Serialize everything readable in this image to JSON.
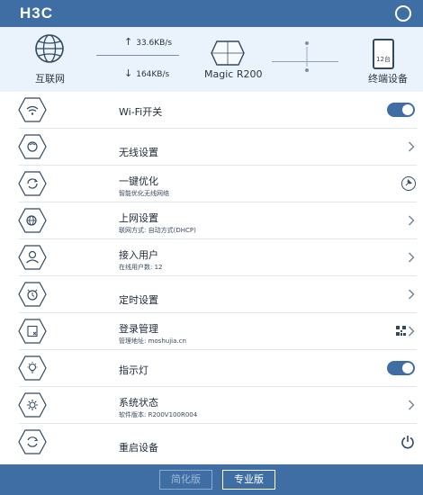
{
  "header": {
    "logo": "H3C",
    "icons": [
      "power-icon"
    ]
  },
  "status": {
    "internet_label": "互联网",
    "upload_rate": "33.6KB/s",
    "download_rate": "164KB/s",
    "router_label": "Magic R200",
    "devices_count": "12台",
    "devices_label": "终端设备"
  },
  "menu": [
    {
      "title": "Wi-Fi开关",
      "control": "toggle",
      "state": "on",
      "icon": "wifi-icon"
    },
    {
      "title": "无线设置",
      "control": "chevron",
      "icon": "wireless-settings-icon"
    },
    {
      "title": "一键优化",
      "subtitle": "智能优化无线网络",
      "control": "pin",
      "icon": "optimize-icon"
    },
    {
      "title": "上网设置",
      "subtitle": "联网方式: 自动方式(DHCP)",
      "control": "chevron",
      "icon": "internet-settings-icon"
    },
    {
      "title": "接入用户",
      "subtitle": "在线用户数: 12",
      "control": "chevron",
      "icon": "users-icon"
    },
    {
      "title": "定时设置",
      "control": "chevron",
      "icon": "timer-icon"
    },
    {
      "title": "登录管理",
      "subtitle": "管理地址: moshujia.cn",
      "control": "qr-chevron",
      "icon": "login-manage-icon"
    },
    {
      "title": "指示灯",
      "control": "toggle",
      "state": "on",
      "icon": "indicator-light-icon"
    },
    {
      "title": "系统状态",
      "subtitle": "软件版本: R200V100R004",
      "control": "chevron",
      "icon": "system-status-icon"
    },
    {
      "title": "重启设备",
      "control": "power",
      "icon": "restart-icon"
    }
  ],
  "footer": {
    "simple_label": "简化版",
    "pro_label": "专业版"
  },
  "colors": {
    "brand": "#3f6ea5",
    "panel": "#eaf3fb"
  }
}
